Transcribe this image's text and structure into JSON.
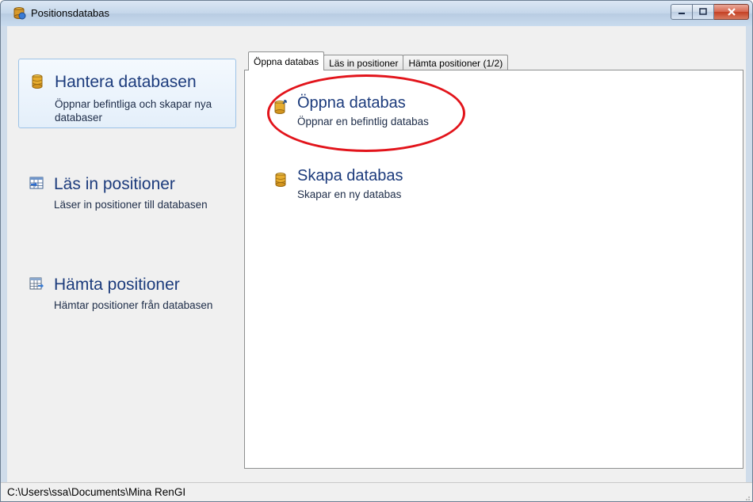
{
  "window": {
    "title": "Positionsdatabas",
    "icon": "database-app-icon"
  },
  "nav": {
    "items": [
      {
        "title": "Hantera databasen",
        "desc": "Öppnar befintliga och skapar nya databaser",
        "icon": "database-icon",
        "selected": true
      },
      {
        "title": "Läs in positioner",
        "desc": "Läser in positioner till databasen",
        "icon": "import-table-icon",
        "selected": false
      },
      {
        "title": "Hämta positioner",
        "desc": "Hämtar positioner från databasen",
        "icon": "export-table-icon",
        "selected": false
      }
    ]
  },
  "tabs": [
    {
      "label": "Öppna databas",
      "active": true
    },
    {
      "label": "Läs in positioner",
      "active": false
    },
    {
      "label": "Hämta positioner (1/2)",
      "active": false
    }
  ],
  "panel": {
    "actions": [
      {
        "title": "Öppna databas",
        "desc": "Öppnar en befintlig databas",
        "icon": "open-database-icon"
      },
      {
        "title": "Skapa databas",
        "desc": "Skapar en ny databas",
        "icon": "new-database-icon"
      }
    ]
  },
  "status": {
    "path": "C:\\Users\\ssa\\Documents\\Mina RenGI"
  },
  "colors": {
    "accent_text": "#1c3b7c",
    "highlight_ellipse": "#e2141b",
    "selected_border": "#9dc3e6"
  }
}
